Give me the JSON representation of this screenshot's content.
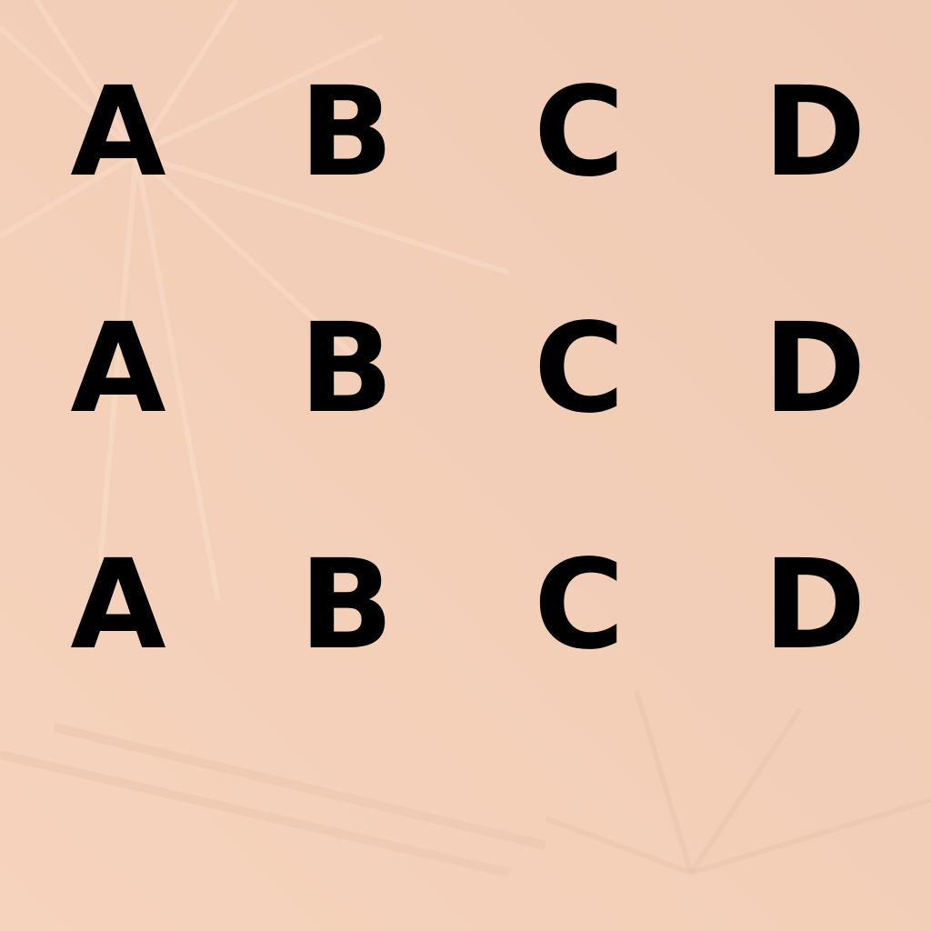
{
  "colors": {
    "background": "#f1cdb6",
    "letter": "#000000"
  },
  "rows": [
    [
      "A",
      "B",
      "C",
      "D"
    ],
    [
      "A",
      "B",
      "C",
      "D"
    ],
    [
      "A",
      "B",
      "C",
      "D"
    ]
  ]
}
